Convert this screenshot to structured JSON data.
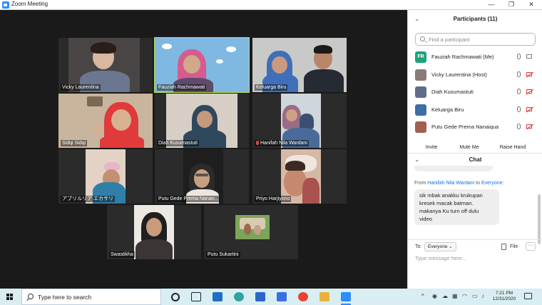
{
  "window": {
    "title": "Zoom Meeting"
  },
  "tiles": [
    {
      "name": "Vicky Laurentina",
      "muted": false,
      "active": false
    },
    {
      "name": "Fauziah Rachmawati",
      "muted": false,
      "active": true
    },
    {
      "name": "Keluarga Biru",
      "muted": false,
      "active": false
    },
    {
      "name": "Sidqi Sidqi",
      "muted": false,
      "active": false
    },
    {
      "name": "Diah Kusumastuti",
      "muted": false,
      "active": false
    },
    {
      "name": "Hanifah Nila Wardani",
      "muted": true,
      "active": false
    },
    {
      "name": "アブリルリア エカサリ",
      "muted": false,
      "active": false
    },
    {
      "name": "Putu Gede Prema Nanan...",
      "muted": false,
      "active": false
    },
    {
      "name": "Priyo Harjiyono",
      "muted": false,
      "active": false
    },
    {
      "name": "Swastikha",
      "muted": false,
      "active": false
    },
    {
      "name": "Putu Sukartini",
      "muted": false,
      "active": false
    }
  ],
  "participants": {
    "title": "Participants (11)",
    "search_placeholder": "Find a participant",
    "list": [
      {
        "initials": "FR",
        "name": "Fauziah Rachmawati (Me)",
        "avatar_color": "#1fa37a",
        "video_off": false
      },
      {
        "initials": "",
        "name": "Vicky Laurentina (Host)",
        "avatar_color": "#8a7b78",
        "video_off": true
      },
      {
        "initials": "",
        "name": "Diah Kusumastuti",
        "avatar_color": "#5f6e88",
        "video_off": true
      },
      {
        "initials": "",
        "name": "Keluarga Biru",
        "avatar_color": "#3d6fa3",
        "video_off": true
      },
      {
        "initials": "",
        "name": "Putu Gede Prema Nanaiqua",
        "avatar_color": "#a06050",
        "video_off": true
      }
    ],
    "buttons": {
      "invite": "Invite",
      "mute_me": "Mute Me",
      "raise_hand": "Raise Hand"
    }
  },
  "chat": {
    "title": "Chat",
    "from_label": "From",
    "from_name": "Hanifah Nila Wardani",
    "to_word": "to",
    "to_name": "Everyone:",
    "message_lines": [
      "sik mbak anakku krukupan",
      "kresek macak batman.",
      "makanya Ku turn off dulu",
      "video"
    ],
    "to_label": "To:",
    "recipient": "Everyone",
    "file_label": "File",
    "more_label": "···",
    "input_placeholder": "Type message here..."
  },
  "taskbar": {
    "search_placeholder": "Type here to search",
    "time": "7:21 PM",
    "date": "12/31/2020"
  }
}
